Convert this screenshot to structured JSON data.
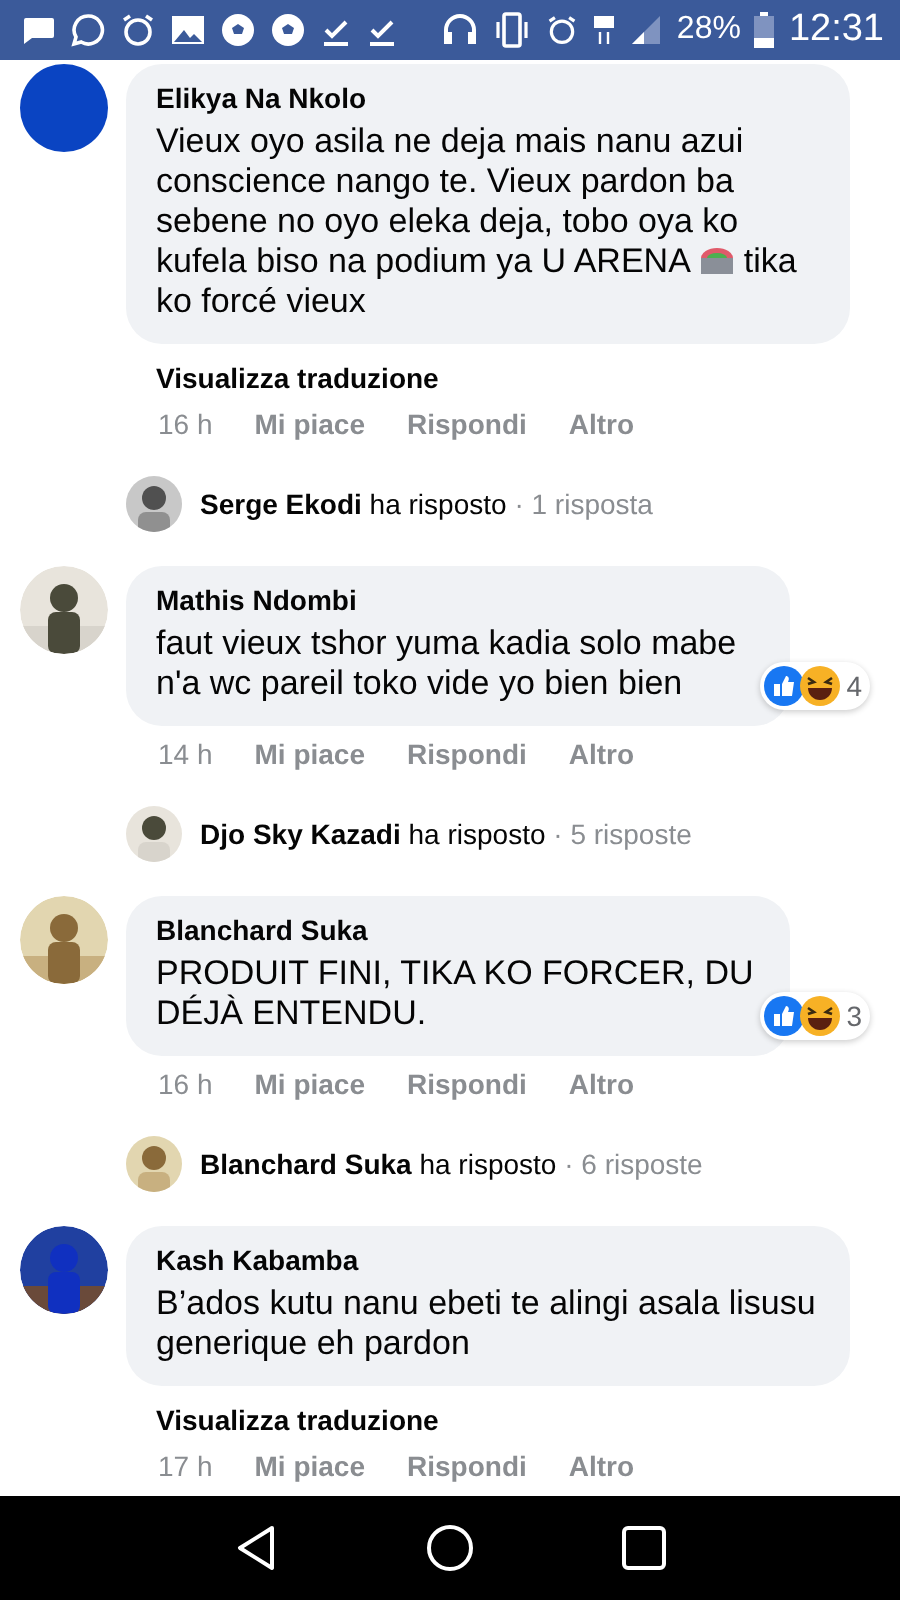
{
  "status_bar": {
    "battery": "28%",
    "time": "12:31"
  },
  "comments": [
    {
      "author": "Elikya Na Nkolo",
      "avatar": {
        "kind": "solid",
        "color": "#0a44c2"
      },
      "text": "Vieux oyo asila ne deja mais nanu azui conscience nango te. Vieux pardon ba sebene no oyo eleka deja, tobo oya ko kufela biso na podium ya U ARENA",
      "text_after_icon": "tika ko forcé vieux",
      "translate": "Visualizza traduzione",
      "time": "16 h",
      "actions": [
        "Mi piace",
        "Rispondi",
        "Altro"
      ],
      "reply": {
        "author": "Serge Ekodi",
        "verb": "ha risposto",
        "count": "· 1 risposta"
      }
    },
    {
      "author": "Mathis Ndombi",
      "avatar": {
        "kind": "picture"
      },
      "text": "faut vieux tshor yuma kadia solo mabe n'a wc pareil toko vide yo bien bien",
      "reactions": "4",
      "time": "14 h",
      "actions": [
        "Mi piace",
        "Rispondi",
        "Altro"
      ],
      "reply": {
        "author": "Djo Sky Kazadi",
        "verb": "ha risposto",
        "count": "· 5 risposte"
      }
    },
    {
      "author": "Blanchard Suka",
      "avatar": {
        "kind": "picture"
      },
      "text": "PRODUIT FINI, TIKA KO FORCER, DU DÉJÀ ENTENDU.",
      "reactions": "3",
      "time": "16 h",
      "actions": [
        "Mi piace",
        "Rispondi",
        "Altro"
      ],
      "reply": {
        "author": "Blanchard Suka",
        "verb": "ha risposto",
        "count": "· 6 risposte"
      }
    },
    {
      "author": "Kash Kabamba",
      "avatar": {
        "kind": "picture"
      },
      "text": "B’ados kutu nanu ebeti te alingi asala lisusu generique eh pardon",
      "translate": "Visualizza traduzione",
      "time": "17 h",
      "actions": [
        "Mi piace",
        "Rispondi",
        "Altro"
      ]
    }
  ]
}
